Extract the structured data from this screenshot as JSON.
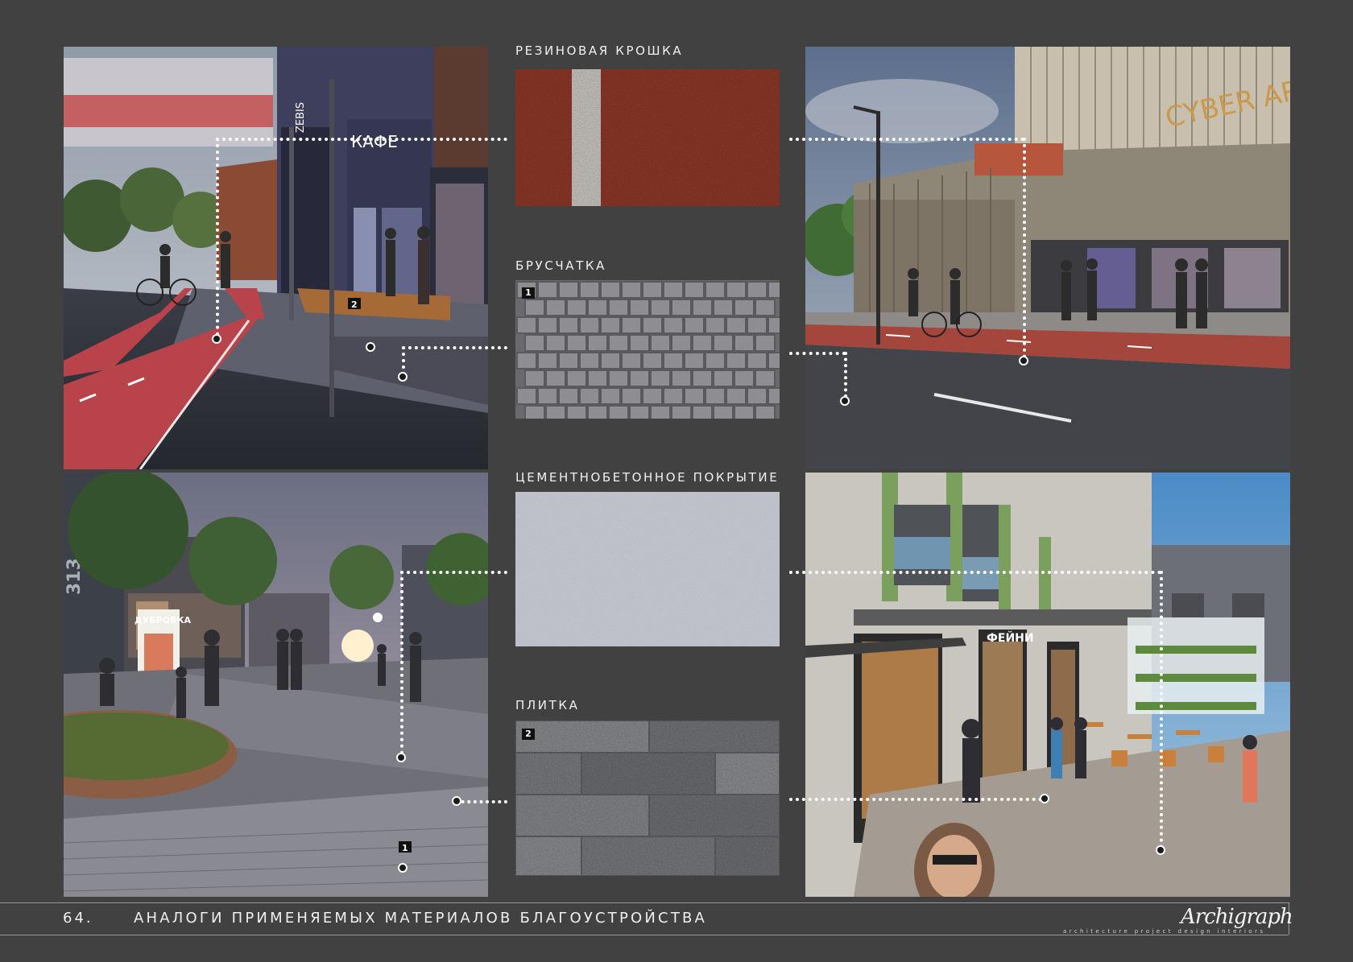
{
  "materials": [
    {
      "label": "РЕЗИНОВАЯ КРОШКА",
      "badge": ""
    },
    {
      "label": "БРУСЧАТКА",
      "badge": "1"
    },
    {
      "label": "ЦЕМЕНТНОБЕТОННОЕ ПОКРЫТИЕ",
      "badge": ""
    },
    {
      "label": "ПЛИТКА",
      "badge": "2"
    }
  ],
  "photo_top_left": {
    "sign_cafe": "КАФЕ",
    "sign_building": "ZEBIS",
    "marker": "2"
  },
  "photo_top_right": {
    "sign": "CYBER AR"
  },
  "photo_bottom_left": {
    "sign": "ДУБРОВКА",
    "marker": "1",
    "building_number": "313"
  },
  "photo_bottom_right": {
    "sign": "ФЕЙНИ"
  },
  "footer": {
    "page_number": "64.",
    "title": "АНАЛОГИ ПРИМЕНЯЕМЫХ МАТЕРИАЛОВ БЛАГОУСТРОЙСТВА",
    "logo": "Archigraph",
    "logo_tagline": "architecture  project  design  interiors"
  },
  "colors": {
    "background": "#414141",
    "rubber": "#a23f2c",
    "leader": "#ffffff"
  }
}
